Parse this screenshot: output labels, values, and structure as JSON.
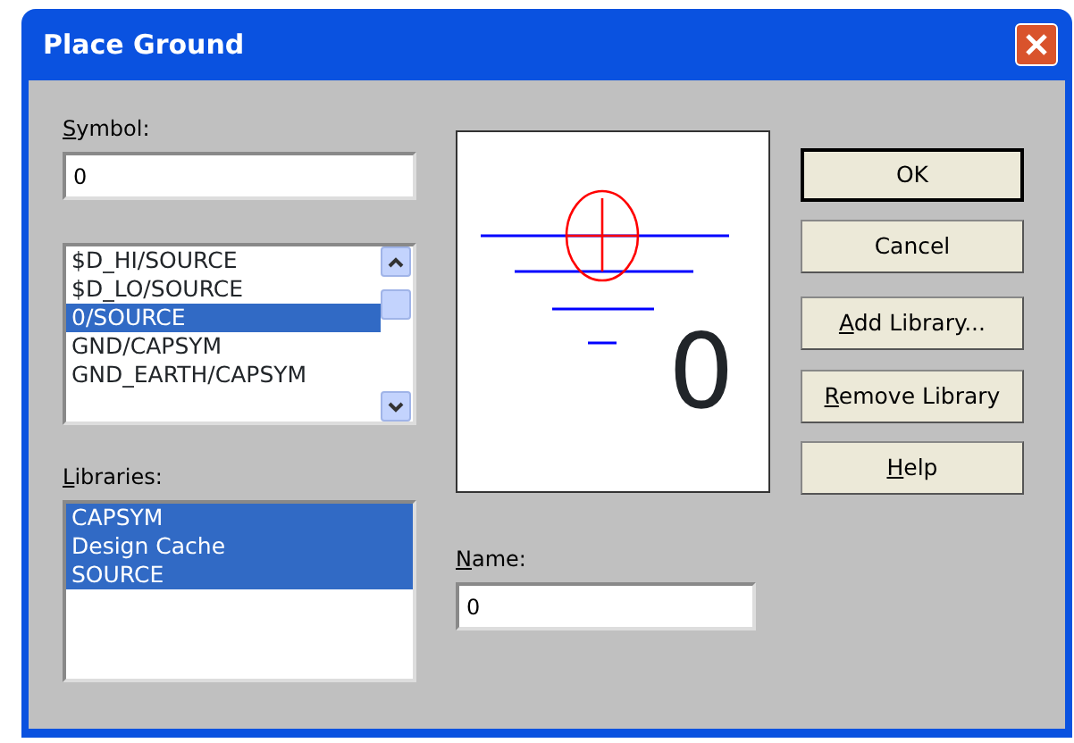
{
  "window": {
    "title": "Place Ground"
  },
  "symbol": {
    "label_accel": "S",
    "label_rest": "ymbol:",
    "value": "0"
  },
  "symbol_list": [
    {
      "text": "$D_HI/SOURCE",
      "selected": false
    },
    {
      "text": "$D_LO/SOURCE",
      "selected": false
    },
    {
      "text": "0/SOURCE",
      "selected": true
    },
    {
      "text": "GND/CAPSYM",
      "selected": false
    },
    {
      "text": "GND_EARTH/CAPSYM",
      "selected": false
    }
  ],
  "libraries": {
    "label_accel": "L",
    "label_rest": "ibraries:",
    "items": [
      {
        "text": "CAPSYM",
        "selected": true
      },
      {
        "text": "Design Cache",
        "selected": true
      },
      {
        "text": "SOURCE",
        "selected": true
      }
    ]
  },
  "preview": {
    "symbol_name": "0"
  },
  "name": {
    "label_accel": "N",
    "label_rest": "ame:",
    "value": "0"
  },
  "buttons": [
    {
      "rest": "OK",
      "default": true
    },
    {
      "rest": "Cancel",
      "default": false
    },
    {
      "accel": "A",
      "rest": "dd Library...",
      "default": false
    },
    {
      "accel": "R",
      "rest": "emove Library",
      "default": false
    },
    {
      "accel": "H",
      "rest": "elp",
      "default": false
    }
  ]
}
